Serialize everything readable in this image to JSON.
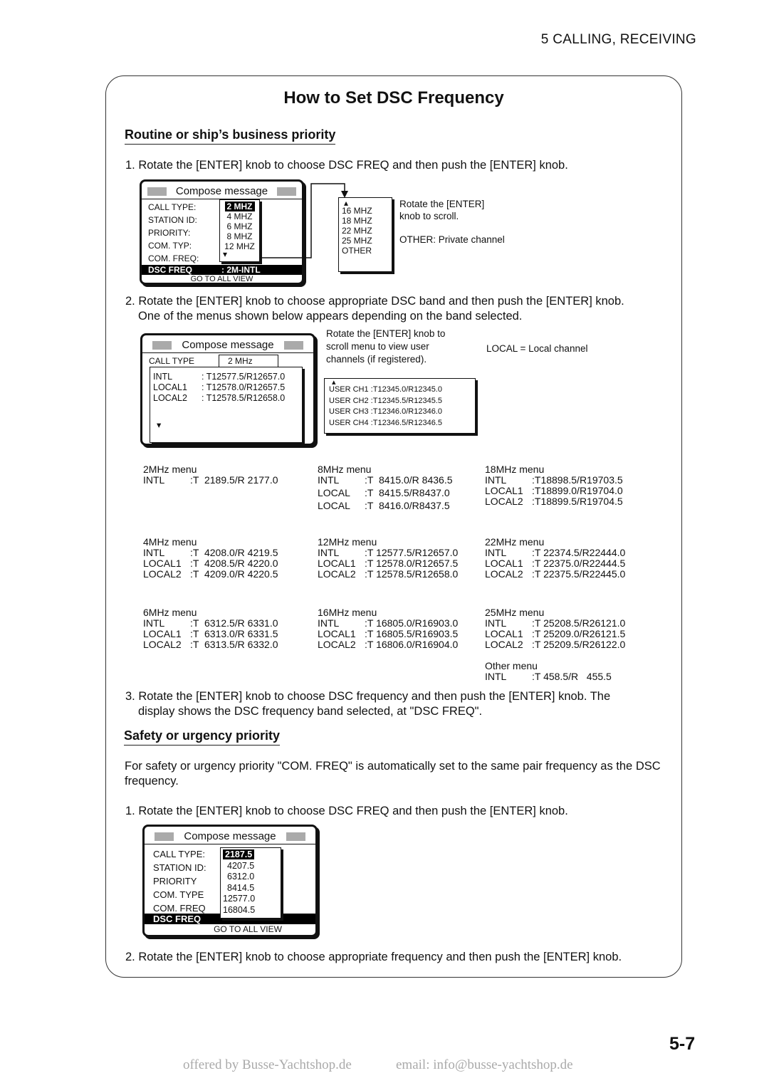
{
  "header": "5   CALLING, RECEIVING",
  "title": "How to Set DSC Frequency",
  "section1": {
    "heading": "Routine or ship’s business priority",
    "step1": "1. Rotate the [ENTER] knob to choose DSC FREQ and then push the [ENTER] knob.",
    "step2a": "2. Rotate the [ENTER] knob to choose appropriate DSC band and then push the [ENTER] knob.",
    "step2b": "One of the menus shown below appears depending on the band selected.",
    "step3a": "3. Rotate the [ENTER] knob to choose DSC frequency and then push the [ENTER] knob. The",
    "step3b": "display shows the DSC frequency band selected, at \"DSC FREQ\"."
  },
  "dialog1": {
    "title": "Compose message",
    "labels": [
      "CALL TYPE:",
      "STATION ID:",
      "PRIORITY:",
      "COM. TYP:",
      "COM. FREQ:"
    ],
    "bar_label": "DSC FREQ",
    "bar_value": ": 2M-INTL",
    "footer": "GO TO ALL VIEW",
    "list": [
      "2 MHZ",
      "4 MHZ",
      "6 MHZ",
      "8 MHZ",
      "12 MHZ"
    ],
    "list2": [
      "16 MHZ",
      "18 MHZ",
      "22 MHZ",
      "25 MHZ",
      "OTHER"
    ],
    "note1": "Rotate the [ENTER] knob to scroll.",
    "note2": "OTHER: Private channel"
  },
  "dialog2": {
    "title": "Compose message",
    "call_type_label": "CALL TYPE",
    "call_type_value": "2 MHz",
    "rows": [
      {
        "n": "INTL",
        "v": ": T12577.5/R12657.0"
      },
      {
        "n": "LOCAL1",
        "v": ": T12578.0/R12657.5"
      },
      {
        "n": "LOCAL2",
        "v": ": T12578.5/R12658.0"
      }
    ],
    "note": "Rotate the [ENTER] knob to scroll menu to view user channels (if registered).",
    "local_note": "LOCAL = Local channel",
    "user": [
      "USER CH1 :T12345.0/R12345.0",
      "USER CH2 :T12345.5/R12345.5",
      "USER CH3 :T12346.0/R12346.0",
      "USER CH4 :T12346.5/R12346.5"
    ]
  },
  "menus": [
    {
      "title": "2MHz menu",
      "rows": [
        [
          "INTL",
          ":T  2189.5/R 2177.0"
        ]
      ]
    },
    {
      "title": "8MHz menu",
      "rows": [
        [
          "INTL",
          ":T  8415.0/R 8436.5"
        ],
        [
          "LOCAL",
          ":T  8415.5/R8437.0"
        ],
        [
          "LOCAL",
          ":T  8416.0/R8437.5"
        ]
      ]
    },
    {
      "title": "18MHz menu",
      "rows": [
        [
          "INTL",
          ":T18898.5/R19703.5"
        ],
        [
          "LOCAL1",
          ":T18899.0/R19704.0"
        ],
        [
          "LOCAL2",
          ":T18899.5/R19704.5"
        ]
      ]
    },
    {
      "title": "4MHz menu",
      "rows": [
        [
          "INTL",
          ":T  4208.0/R 4219.5"
        ],
        [
          "LOCAL1",
          ":T  4208.5/R 4220.0"
        ],
        [
          "LOCAL2",
          ":T  4209.0/R 4220.5"
        ]
      ]
    },
    {
      "title": "12MHz menu",
      "rows": [
        [
          "INTL",
          ":T 12577.5/R12657.0"
        ],
        [
          "LOCAL1",
          ":T 12578.0/R12657.5"
        ],
        [
          "LOCAL2",
          ":T 12578.5/R12658.0"
        ]
      ]
    },
    {
      "title": "22MHz menu",
      "rows": [
        [
          "INTL",
          ":T 22374.5/R22444.0"
        ],
        [
          "LOCAL1",
          ":T 22375.0/R22444.5"
        ],
        [
          "LOCAL2",
          ":T 22375.5/R22445.0"
        ]
      ]
    },
    {
      "title": "6MHz menu",
      "rows": [
        [
          "INTL",
          ":T  6312.5/R 6331.0"
        ],
        [
          "LOCAL1",
          ":T  6313.0/R 6331.5"
        ],
        [
          "LOCAL2",
          ":T  6313.5/R 6332.0"
        ]
      ]
    },
    {
      "title": "16MHz menu",
      "rows": [
        [
          "INTL",
          ":T 16805.0/R16903.0"
        ],
        [
          "LOCAL1",
          ":T 16805.5/R16903.5"
        ],
        [
          "LOCAL2",
          ":T 16806.0/R16904.0"
        ]
      ]
    },
    {
      "title": "25MHz menu",
      "rows": [
        [
          "INTL",
          ":T 25208.5/R26121.0"
        ],
        [
          "LOCAL1",
          ":T 25209.0/R26121.5"
        ],
        [
          "LOCAL2",
          ":T 25209.5/R26122.0"
        ]
      ]
    },
    {
      "title": "Other menu",
      "rows": [
        [
          "INTL",
          ":T 458.5/R   455.5"
        ]
      ]
    }
  ],
  "section2": {
    "heading": "Safety or urgency priority",
    "para": "For safety or urgency priority \"COM. FREQ\" is automatically set to the same pair frequency as the DSC frequency.",
    "step1": "1. Rotate the [ENTER] knob to choose DSC FREQ and then push the [ENTER] knob.",
    "step2": "2. Rotate the [ENTER] knob to choose appropriate frequency and then push the [ENTER] knob."
  },
  "dialog3": {
    "title": "Compose message",
    "labels": [
      "CALL TYPE:",
      "STATION ID:",
      "PRIORITY",
      "COM. TYPE",
      "COM. FREQ"
    ],
    "bar_label": "DSC FREQ",
    "footer": "GO TO ALL VIEW",
    "list": [
      "2187.5",
      "4207.5",
      "6312.0",
      "8414.5",
      "12577.0",
      "16804.5"
    ]
  },
  "page_number": "5-7",
  "watermark": {
    "left": "offered by Busse-Yachtshop.de",
    "right": "email: info@busse-yachtshop.de"
  }
}
